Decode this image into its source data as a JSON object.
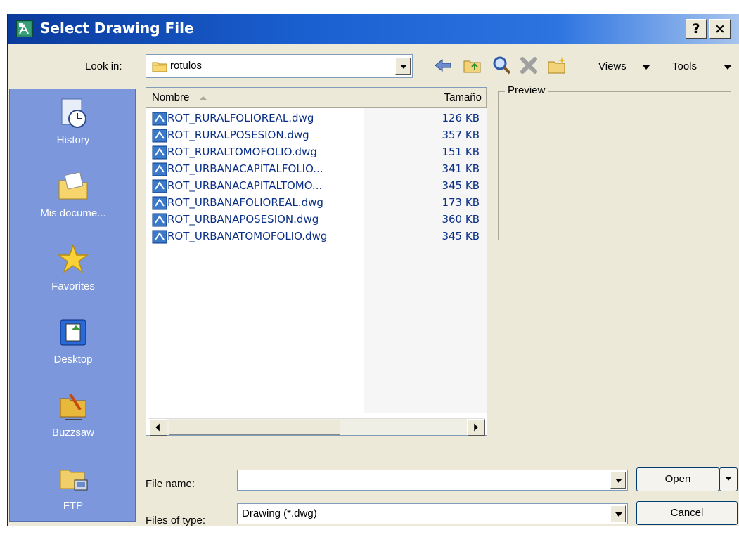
{
  "window": {
    "title": "Select Drawing File",
    "help_label": "?",
    "close_label": "×"
  },
  "toolbar": {
    "look_in_label": "Look in:",
    "look_in_value": "rotulos",
    "views_label": "Views",
    "tools_label": "Tools"
  },
  "places": [
    {
      "label": "History",
      "icon": "history-icon"
    },
    {
      "label": "Mis docume...",
      "icon": "my-documents-icon"
    },
    {
      "label": "Favorites",
      "icon": "favorites-icon"
    },
    {
      "label": "Desktop",
      "icon": "desktop-icon"
    },
    {
      "label": "Buzzsaw",
      "icon": "buzzsaw-icon"
    },
    {
      "label": "FTP",
      "icon": "ftp-icon"
    }
  ],
  "file_list": {
    "columns": [
      "Nombre",
      "Tamaño"
    ],
    "files": [
      {
        "name": "ROT_RURALFOLIOREAL.dwg",
        "size": "126 KB"
      },
      {
        "name": "ROT_RURALPOSESION.dwg",
        "size": "357 KB"
      },
      {
        "name": "ROT_RURALTOMOFOLIO.dwg",
        "size": "151 KB"
      },
      {
        "name": "ROT_URBANACAPITALFOLIO...",
        "size": "341 KB"
      },
      {
        "name": "ROT_URBANACAPITALTOMO...",
        "size": "345 KB"
      },
      {
        "name": "ROT_URBANAFOLIOREAL.dwg",
        "size": "173 KB"
      },
      {
        "name": "ROT_URBANAPOSESION.dwg",
        "size": "360 KB"
      },
      {
        "name": "ROT_URBANATOMOFOLIO.dwg",
        "size": "345 KB"
      }
    ]
  },
  "preview": {
    "label": "Preview"
  },
  "bottom": {
    "file_name_label": "File name:",
    "file_name_value": "",
    "file_type_label": "Files of type:",
    "file_type_value": "Drawing (*.dwg)",
    "open_label": "Open",
    "cancel_label": "Cancel"
  },
  "colors": {
    "titlebar": "#0a3a9c",
    "places_bar": "#7c97dc",
    "file_text": "#0a2f86",
    "dialog_bg": "#ece9d8"
  }
}
